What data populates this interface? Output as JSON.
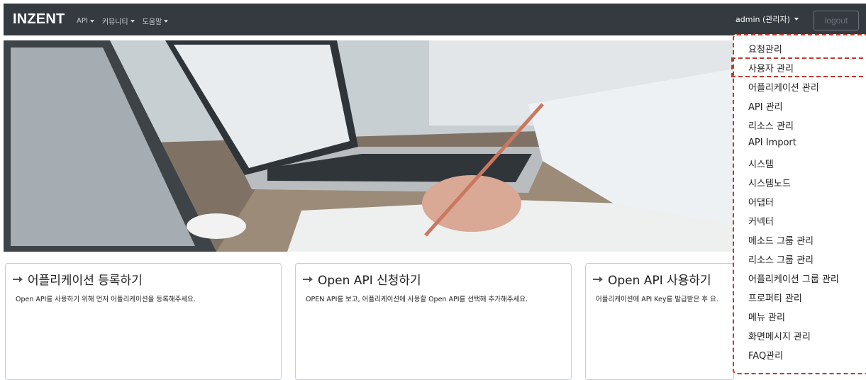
{
  "navbar": {
    "brand": "INZENT",
    "menu": [
      "API",
      "커뮤니티",
      "도움말"
    ],
    "user_label": "admin (관리자)",
    "logout_label": "logout"
  },
  "cards": [
    {
      "title": "어플리케이션 등록하기",
      "description": "Open API를 사용하기 위해 먼저 어플리케이션을 등록해주세요."
    },
    {
      "title": "Open API 신청하기",
      "description": "OPEN API를 보고, 어플리케이션에 사용할 Open API를 선택해 추가해주세요."
    },
    {
      "title": "Open API 사용하기",
      "description": "어플리케이션에 API Key를 발급받은 후 요."
    }
  ],
  "dropdown": {
    "items": [
      "요청관리",
      "사용자 관리",
      "어플리케이션 관리",
      "API 관리",
      "리소스 관리",
      "API Import",
      "시스템",
      "시스템노드",
      "어댑터",
      "커넥터",
      "메소드 그룹 관리",
      "리소스 그룹 관리",
      "어플리케이션 그룹 관리",
      "프로퍼티 관리",
      "메뉴 관리",
      "화면메시지 관리",
      "FAQ관리"
    ],
    "highlighted_index": 1,
    "highlight_color": "#c0392b"
  },
  "icons": {
    "card_title": "hand-pointing-icon",
    "dropdown_caret": "caret-down-icon"
  },
  "colors": {
    "navbar_bg": "#343a40",
    "nav_text": "#c9ccd0",
    "logout_border": "#6c757d"
  }
}
